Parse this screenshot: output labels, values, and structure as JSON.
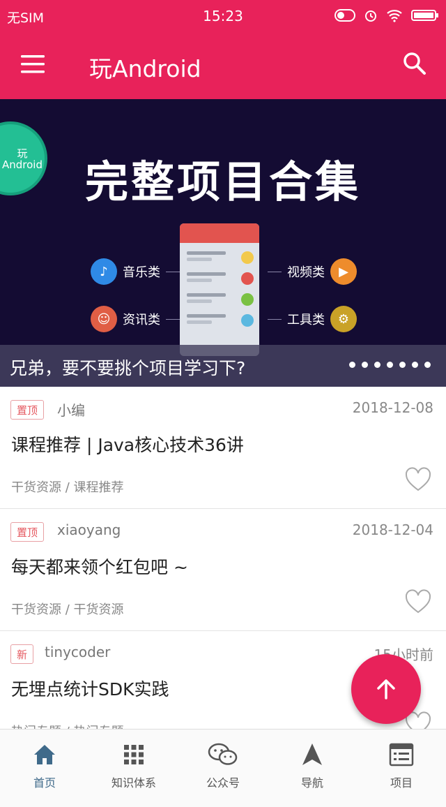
{
  "status_bar": {
    "carrier": "无SIM",
    "time": "15:23"
  },
  "app_bar": {
    "title": "玩Android",
    "menu_icon": "hamburger-menu-icon",
    "search_icon": "search-icon",
    "color": "#e8225a"
  },
  "banner": {
    "logo_text": "玩Android",
    "title": "完整项目合集",
    "categories": {
      "music": "音乐类",
      "news": "资讯类",
      "video": "视频类",
      "tools": "工具类"
    },
    "caption": "兄弟，要不要挑个项目学习下?",
    "page_dot_count": 7
  },
  "articles": [
    {
      "tag": "置顶",
      "author": "小编",
      "date": "2018-12-08",
      "title": "课程推荐 | Java核心技术36讲",
      "chapter": "干货资源 / 课程推荐"
    },
    {
      "tag": "置顶",
      "author": "xiaoyang",
      "date": "2018-12-04",
      "title": "每天都来领个红包吧 ~",
      "chapter": "干货资源 / 干货资源"
    },
    {
      "tag": "新",
      "author": "tinycoder",
      "date": "15小时前",
      "title": "无埋点统计SDK实践",
      "chapter": "热门专题 / 热门专题"
    }
  ],
  "fab_icon": "arrow-up-icon",
  "bottom_nav": [
    {
      "label": "首页",
      "icon": "home-icon"
    },
    {
      "label": "知识体系",
      "icon": "grid-icon"
    },
    {
      "label": "公众号",
      "icon": "wechat-icon"
    },
    {
      "label": "导航",
      "icon": "navigation-icon"
    },
    {
      "label": "项目",
      "icon": "project-icon"
    }
  ]
}
